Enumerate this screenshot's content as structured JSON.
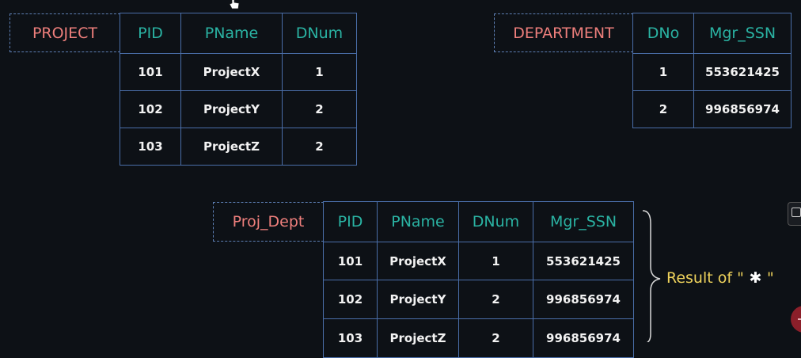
{
  "project": {
    "label": "PROJECT",
    "headers": [
      "PID",
      "PName",
      "DNum"
    ],
    "rows": [
      [
        "101",
        "ProjectX",
        "1"
      ],
      [
        "102",
        "ProjectY",
        "2"
      ],
      [
        "103",
        "ProjectZ",
        "2"
      ]
    ]
  },
  "department": {
    "label": "DEPARTMENT",
    "headers": [
      "DNo",
      "Mgr_SSN"
    ],
    "rows": [
      [
        "1",
        "553621425"
      ],
      [
        "2",
        "996856974"
      ]
    ]
  },
  "proj_dept": {
    "label": "Proj_Dept",
    "headers": [
      "PID",
      "PName",
      "DNum",
      "Mgr_SSN"
    ],
    "rows": [
      [
        "101",
        "ProjectX",
        "1",
        "553621425"
      ],
      [
        "102",
        "ProjectY",
        "2",
        "996856974"
      ],
      [
        "103",
        "ProjectZ",
        "2",
        "996856974"
      ]
    ]
  },
  "annotation": {
    "text": "Result of",
    "quote_open": " \"",
    "symbol": " ✱ ",
    "quote_close": "\""
  },
  "colors": {
    "label": "#ee7f7c",
    "header": "#2ab3a3",
    "border": "#4a6ea9",
    "annotation": "#efd35c"
  }
}
